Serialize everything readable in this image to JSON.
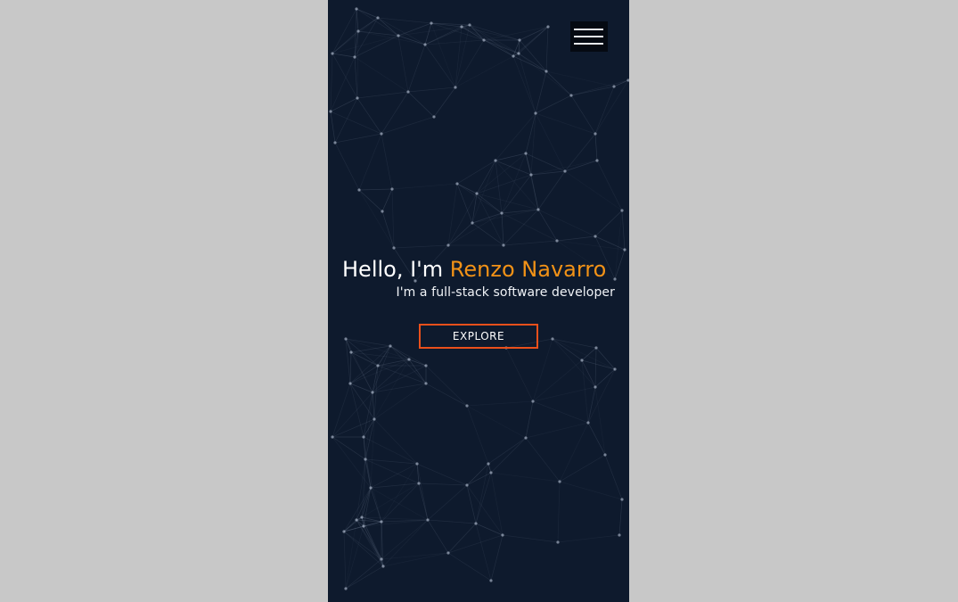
{
  "page": {
    "background_color": "#c8c8c8",
    "viewport_color": "#0e1a2d"
  },
  "header": {
    "menu_icon": "hamburger-menu-icon"
  },
  "hero": {
    "greeting": "Hello, I'm",
    "name": "Renzo Navarro",
    "subtitle": "I'm a full-stack software developer",
    "name_color": "#f29217"
  },
  "cta": {
    "label": "EXPLORE",
    "border_color": "#e9501b"
  }
}
